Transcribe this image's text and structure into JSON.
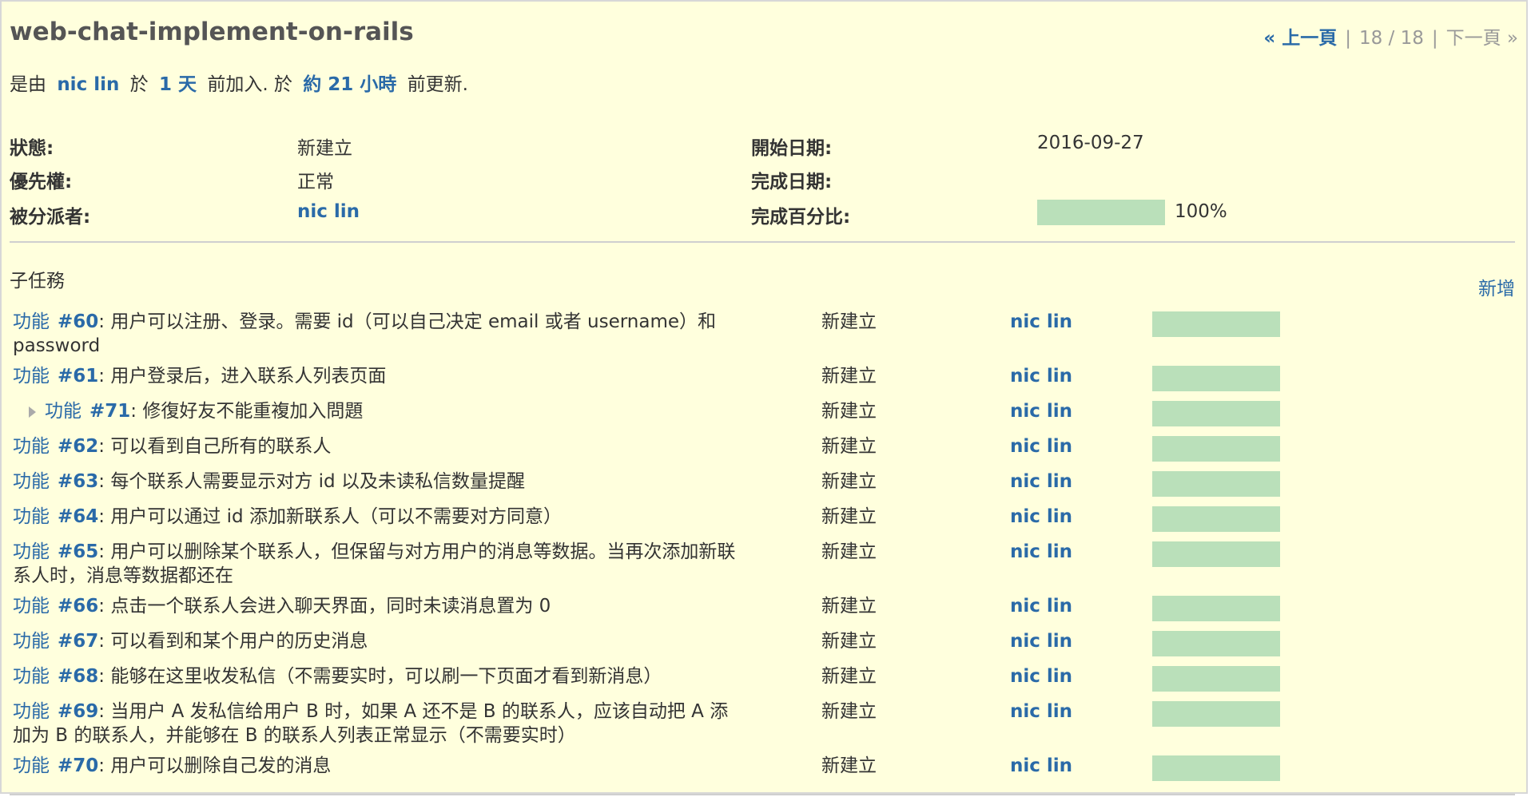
{
  "issue": {
    "title": "web-chat-implement-on-rails",
    "pager": {
      "prev_icon": "«",
      "prev_label": "上一頁",
      "position": "18 / 18",
      "next_label": "下一頁",
      "next_icon": "»",
      "separator": "|"
    },
    "author_line": {
      "prefix": "是由",
      "author": "nic lin",
      "p1": "於",
      "created": "1 天",
      "p2": "前加入. 於",
      "updated": "約 21 小時",
      "p3": "前更新."
    },
    "attributes": {
      "status_label": "狀態:",
      "status": "新建立",
      "priority_label": "優先權:",
      "priority": "正常",
      "assignee_label": "被分派者:",
      "assignee": "nic lin",
      "start_label": "開始日期:",
      "start": "2016-09-27",
      "due_label": "完成日期:",
      "due": "",
      "done_label": "完成百分比:",
      "done_text": "100%",
      "done_fraction": 1.0
    }
  },
  "subtasks": {
    "title": "子任務",
    "add_label": "新增",
    "rows": [
      {
        "tracker": "功能",
        "number": "#60",
        "subject": ": 用户可以注册、登录。需要 id（可以自己决定 email 或者 username）和 password",
        "status": "新建立",
        "assignee": "nic lin",
        "done": 1.0
      },
      {
        "tracker": "功能",
        "number": "#61",
        "subject": ": 用户登录后，进入联系人列表页面",
        "status": "新建立",
        "assignee": "nic lin",
        "done": 1.0
      },
      {
        "tracker": "功能",
        "number": "#71",
        "subject": ": 修復好友不能重複加入問題",
        "status": "新建立",
        "assignee": "nic lin",
        "done": 1.0
      },
      {
        "tracker": "功能",
        "number": "#62",
        "subject": ": 可以看到自己所有的联系人",
        "status": "新建立",
        "assignee": "nic lin",
        "done": 1.0
      },
      {
        "tracker": "功能",
        "number": "#63",
        "subject": ": 每个联系人需要显示对方 id 以及未读私信数量提醒",
        "status": "新建立",
        "assignee": "nic lin",
        "done": 1.0
      },
      {
        "tracker": "功能",
        "number": "#64",
        "subject": ": 用户可以通过 id 添加新联系人（可以不需要对方同意）",
        "status": "新建立",
        "assignee": "nic lin",
        "done": 1.0
      },
      {
        "tracker": "功能",
        "number": "#65",
        "subject": ": 用户可以删除某个联系人，但保留与对方用户的消息等数据。当再次添加新联系人时，消息等数据都还在",
        "status": "新建立",
        "assignee": "nic lin",
        "done": 1.0
      },
      {
        "tracker": "功能",
        "number": "#66",
        "subject": ": 点击一个联系人会进入聊天界面，同时未读消息置为 0",
        "status": "新建立",
        "assignee": "nic lin",
        "done": 1.0
      },
      {
        "tracker": "功能",
        "number": "#67",
        "subject": ": 可以看到和某个用户的历史消息",
        "status": "新建立",
        "assignee": "nic lin",
        "done": 1.0
      },
      {
        "tracker": "功能",
        "number": "#68",
        "subject": ": 能够在这里收发私信（不需要实时，可以刷一下页面才看到新消息）",
        "status": "新建立",
        "assignee": "nic lin",
        "done": 1.0
      },
      {
        "tracker": "功能",
        "number": "#69",
        "subject": ": 当用户 A 发私信给用户 B 时，如果 A 还不是 B 的联系人，应该自动把 A 添加为 B 的联系人，并能够在 B 的联系人列表正常显示（不需要实时）",
        "status": "新建立",
        "assignee": "nic lin",
        "done": 1.0
      },
      {
        "tracker": "功能",
        "number": "#70",
        "subject": ": 用户可以删除自己发的消息",
        "status": "新建立",
        "assignee": "nic lin",
        "done": 1.0
      }
    ]
  },
  "colors": {
    "background": "#ffffdd",
    "link": "#2a6aa8",
    "progress_fill": "#bae0ba"
  }
}
